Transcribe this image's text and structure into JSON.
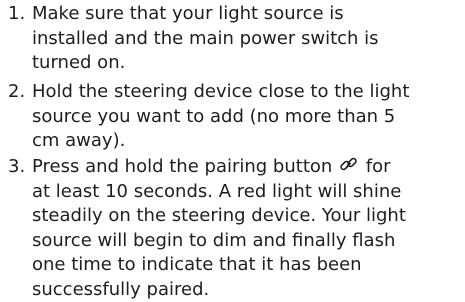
{
  "steps": [
    {
      "number": "1.",
      "lines": [
        "Make sure that your light source is",
        "installed and the main power switch is",
        "turned on."
      ]
    },
    {
      "number": "2.",
      "lines": [
        "Hold the steering device close to the light",
        "source you want to add (no more than 5",
        "cm away)."
      ]
    },
    {
      "number": "3.",
      "line_1_before_icon": "Press and hold the pairing button",
      "line_1_after_icon": "for",
      "inline_icon": "pairing-link-icon",
      "lines": [
        "at least 10 seconds. A red light will shine",
        "steadily on the steering device. Your light",
        "source will begin to dim and finally flash",
        "one time to indicate that it has been",
        "successfully paired."
      ]
    }
  ],
  "colors": {
    "text": "#1e1e1e",
    "background": "#ffffff"
  }
}
